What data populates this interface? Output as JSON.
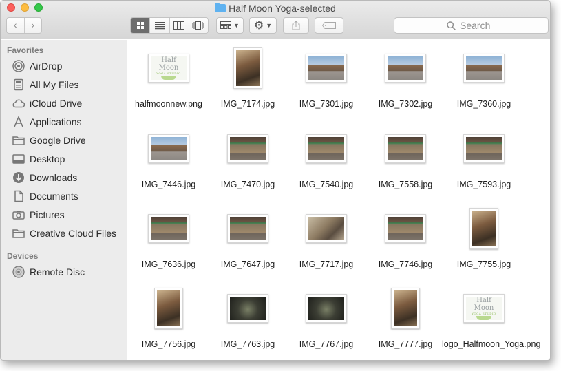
{
  "window": {
    "title": "Half Moon Yoga-selected"
  },
  "toolbar": {
    "back_glyph": "‹",
    "forward_glyph": "›",
    "search_placeholder": "Search"
  },
  "sidebar": {
    "favorites_heading": "Favorites",
    "favorites": [
      {
        "label": "AirDrop",
        "icon": "airdrop-icon"
      },
      {
        "label": "All My Files",
        "icon": "all-files-icon"
      },
      {
        "label": "iCloud Drive",
        "icon": "cloud-icon"
      },
      {
        "label": "Applications",
        "icon": "applications-icon"
      },
      {
        "label": "Google Drive",
        "icon": "folder-icon"
      },
      {
        "label": "Desktop",
        "icon": "desktop-icon"
      },
      {
        "label": "Downloads",
        "icon": "downloads-icon"
      },
      {
        "label": "Documents",
        "icon": "documents-icon"
      },
      {
        "label": "Pictures",
        "icon": "camera-icon"
      },
      {
        "label": "Creative Cloud Files",
        "icon": "folder-icon"
      }
    ],
    "devices_heading": "Devices",
    "devices": [
      {
        "label": "Remote Disc",
        "icon": "disc-icon"
      }
    ]
  },
  "files": [
    {
      "name": "halfmoonnew.png",
      "kind": "logo"
    },
    {
      "name": "IMG_7174.jpg",
      "kind": "portrait"
    },
    {
      "name": "IMG_7301.jpg",
      "kind": "street"
    },
    {
      "name": "IMG_7302.jpg",
      "kind": "street"
    },
    {
      "name": "IMG_7360.jpg",
      "kind": "street"
    },
    {
      "name": "IMG_7446.jpg",
      "kind": "street"
    },
    {
      "name": "IMG_7470.jpg",
      "kind": "storefront"
    },
    {
      "name": "IMG_7540.jpg",
      "kind": "storefront"
    },
    {
      "name": "IMG_7558.jpg",
      "kind": "storefront"
    },
    {
      "name": "IMG_7593.jpg",
      "kind": "storefront"
    },
    {
      "name": "IMG_7636.jpg",
      "kind": "storefront"
    },
    {
      "name": "IMG_7647.jpg",
      "kind": "storefront"
    },
    {
      "name": "IMG_7717.jpg",
      "kind": "interior"
    },
    {
      "name": "IMG_7746.jpg",
      "kind": "storefront"
    },
    {
      "name": "IMG_7755.jpg",
      "kind": "portrait"
    },
    {
      "name": "IMG_7756.jpg",
      "kind": "portrait"
    },
    {
      "name": "IMG_7763.jpg",
      "kind": "dark"
    },
    {
      "name": "IMG_7767.jpg",
      "kind": "dark"
    },
    {
      "name": "IMG_7777.jpg",
      "kind": "portrait"
    },
    {
      "name": "logo_Halfmoon_Yoga.png",
      "kind": "logo"
    }
  ],
  "logo_text": {
    "line1": "Half Moon",
    "line2": "YOGA STUDIO"
  },
  "colors": {
    "folder_blue": "#5fb2f0",
    "sidebar_bg": "#ececec",
    "logo_green": "#8cbb58"
  }
}
